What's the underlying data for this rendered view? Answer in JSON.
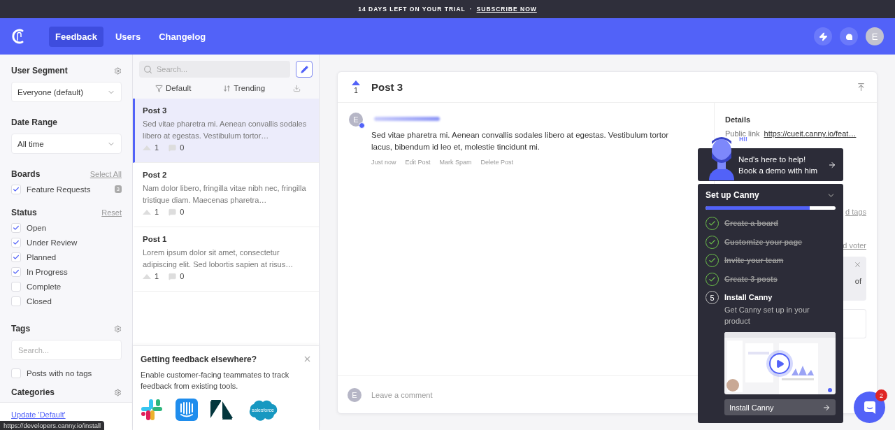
{
  "trial_banner": {
    "text": "14 DAYS LEFT ON YOUR TRIAL",
    "separator": "·",
    "link": "SUBSCRIBE NOW"
  },
  "nav": {
    "tabs": [
      {
        "label": "Feedback",
        "selected": true
      },
      {
        "label": "Users",
        "selected": false
      },
      {
        "label": "Changelog",
        "selected": false
      }
    ],
    "avatar": "E"
  },
  "sidebar": {
    "user_segment": {
      "title": "User Segment",
      "value": "Everyone (default)"
    },
    "date_range": {
      "title": "Date Range",
      "value": "All time"
    },
    "boards": {
      "title": "Boards",
      "action": "Select All",
      "items": [
        {
          "label": "Feature Requests",
          "checked": true,
          "count": "3"
        }
      ]
    },
    "status": {
      "title": "Status",
      "action": "Reset",
      "items": [
        {
          "label": "Open",
          "checked": true
        },
        {
          "label": "Under Review",
          "checked": true
        },
        {
          "label": "Planned",
          "checked": true
        },
        {
          "label": "In Progress",
          "checked": true
        },
        {
          "label": "Complete",
          "checked": false
        },
        {
          "label": "Closed",
          "checked": false
        }
      ]
    },
    "tags": {
      "title": "Tags",
      "placeholder": "Search...",
      "items": [
        {
          "label": "Posts with no tags",
          "checked": false
        }
      ]
    },
    "categories": {
      "title": "Categories"
    },
    "footer_link": "Update 'Default'"
  },
  "status_tooltip": "https://developers.canny.io/install",
  "post_list": {
    "search_placeholder": "Search...",
    "filter": "Default",
    "sort": "Trending",
    "posts": [
      {
        "title": "Post 3",
        "excerpt": "Sed vitae pharetra mi. Aenean convallis sodales libero at egestas. Vestibulum tortor…",
        "votes": "1",
        "comments": "0",
        "selected": true
      },
      {
        "title": "Post 2",
        "excerpt": "Nam dolor libero, fringilla vitae nibh nec, fringilla tristique diam. Maecenas pharetra…",
        "votes": "1",
        "comments": "0",
        "selected": false
      },
      {
        "title": "Post 1",
        "excerpt": "Lorem ipsum dolor sit amet, consectetur adipiscing elit. Sed lobortis sapien at risus…",
        "votes": "1",
        "comments": "0",
        "selected": false
      }
    ],
    "promo": {
      "title": "Getting feedback elsewhere?",
      "text": "Enable customer-facing teammates to track feedback from existing tools.",
      "logo_text": "salesforce"
    }
  },
  "post": {
    "votes": "1",
    "title": "Post 3",
    "author_avatar": "E",
    "body": "Sed vitae pharetra mi. Aenean convallis sodales libero at egestas. Vestibulum tortor lacus, bibendum id leo et, molestie tincidunt mi.",
    "meta": [
      "Just now",
      "Edit Post",
      "Mark Spam",
      "Delete Post"
    ],
    "commenter_avatar": "E",
    "comment_placeholder": "Leave a comment"
  },
  "details": {
    "title": "Details",
    "link_label": "Public link",
    "link": "https://cueit.canny.io/feat…",
    "tags_fragment": "d tags",
    "voter_fragment": "d voter",
    "notice_fragment": "of"
  },
  "ned": {
    "greeting": "HI!",
    "lines": [
      "Ned's here to help!",
      "Book a demo with him"
    ]
  },
  "setup": {
    "title": "Set up Canny",
    "expanded": true,
    "level": 0.8,
    "steps": [
      {
        "label": "Create a board",
        "done": true
      },
      {
        "label": "Customize your page",
        "done": true
      },
      {
        "label": "Invite your team",
        "done": true
      },
      {
        "label": "Create 3 posts",
        "done": true
      },
      {
        "label": "Install Canny",
        "done": false,
        "number": "5",
        "description": "Get Canny set up in your product",
        "button": "Install Canny"
      }
    ]
  },
  "messenger": {
    "badge": "2"
  }
}
